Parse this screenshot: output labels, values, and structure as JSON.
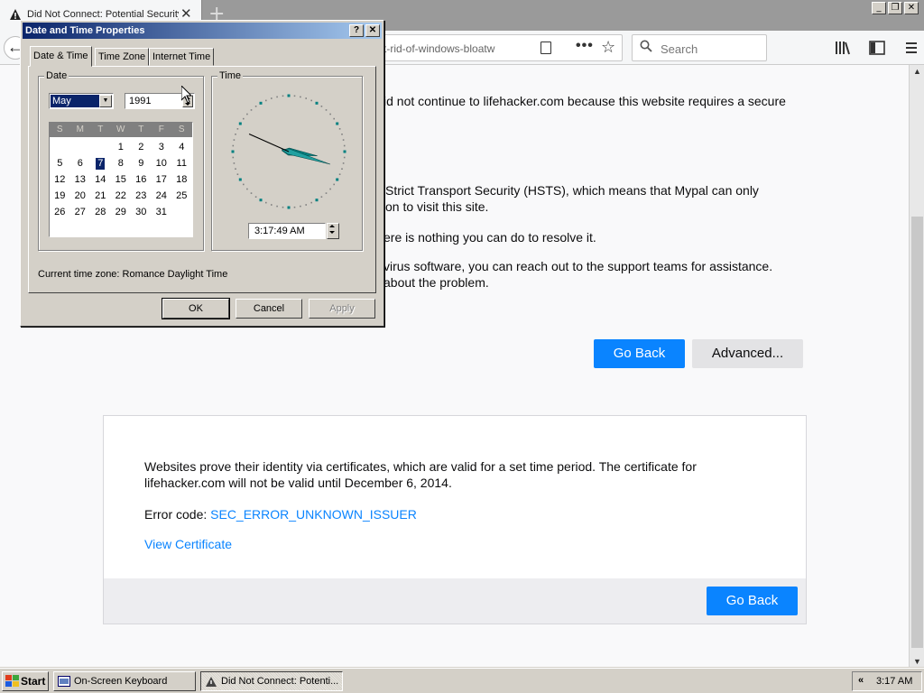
{
  "browser": {
    "tab_title": "Did Not Connect: Potential Security Issue",
    "new_tab_symbol": "+",
    "url_fragment": "t-rid-of-windows-bloatw",
    "search_placeholder": "Search",
    "window_controls": [
      "_",
      "❐",
      "✕"
    ]
  },
  "page": {
    "line1": "id not continue to lifehacker.com because this website requires a secure",
    "line2": "Strict Transport Security (HSTS), which means that Mypal can only\non to visit this site.",
    "line3": "ere is nothing you can do to resolve it.",
    "line4": "virus software, you can reach out to the support teams for assistance.\nabout the problem.",
    "go_back_label": "Go Back",
    "advanced_label": "Advanced...",
    "advanced": {
      "explanation": "Websites prove their identity via certificates, which are valid for a set time period. The certificate for lifehacker.com will not be valid until December 6, 2014.",
      "error_label": "Error code: ",
      "error_code": "SEC_ERROR_UNKNOWN_ISSUER",
      "view_certificate": "View Certificate",
      "go_back_label": "Go Back"
    }
  },
  "dialog": {
    "title": "Date and Time Properties",
    "help": "?",
    "close": "✕",
    "tabs": [
      "Date & Time",
      "Time Zone",
      "Internet Time"
    ],
    "date_group_label": "Date",
    "time_group_label": "Time",
    "month": "May",
    "year": "1991",
    "weekdays": [
      "S",
      "M",
      "T",
      "W",
      "T",
      "F",
      "S"
    ],
    "calendar_rows": [
      [
        "",
        "",
        "",
        "1",
        "2",
        "3",
        "4"
      ],
      [
        "5",
        "6",
        "7",
        "8",
        "9",
        "10",
        "11"
      ],
      [
        "12",
        "13",
        "14",
        "15",
        "16",
        "17",
        "18"
      ],
      [
        "19",
        "20",
        "21",
        "22",
        "23",
        "24",
        "25"
      ],
      [
        "26",
        "27",
        "28",
        "29",
        "30",
        "31",
        ""
      ]
    ],
    "selected_day": "7",
    "time": "3:17:49 AM",
    "clock": {
      "hour": 3,
      "minute": 17,
      "second": 49
    },
    "timezone_label": "Current time zone:  Romance Daylight Time",
    "ok": "OK",
    "cancel": "Cancel",
    "apply": "Apply"
  },
  "taskbar": {
    "start": "Start",
    "tasks": [
      "On-Screen Keyboard",
      "Did Not Connect: Potenti..."
    ],
    "tray_chevron": "«",
    "clock": "3:17 AM"
  },
  "colors": {
    "accent_blue": "#0a84ff",
    "title_bar": "#0a246a",
    "classic_gray": "#d4d0c8"
  }
}
